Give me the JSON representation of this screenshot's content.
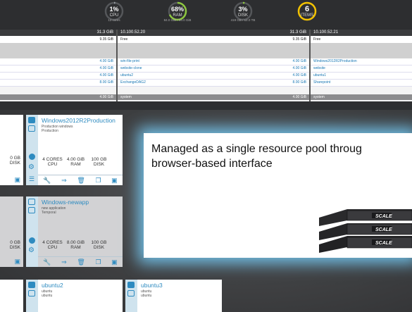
{
  "gauges": [
    {
      "value": "1%",
      "label": "CPU",
      "sub": "12 cores",
      "color": "#9aa0a6",
      "fraction": 0.01
    },
    {
      "value": "68%",
      "label": "RAM",
      "sub": "84.0 GiB / 94.0 GiB",
      "color": "#8dc63f",
      "fraction": 0.68
    },
    {
      "value": "3%",
      "label": "DISK",
      "sub": "419 GB / 12.0 TB",
      "color": "#8dc63f",
      "fraction": 0.03
    },
    {
      "value": "6",
      "label": "ITEMS",
      "sub": "",
      "color": "#f2c200",
      "fraction": 1.0
    }
  ],
  "nodes": [
    {
      "name": "",
      "capacity": "31.3 GiB",
      "free_label": "",
      "free_value": "9.35 GiB",
      "vms": [
        {
          "name": "",
          "size": "4.00 GiB"
        },
        {
          "name": "",
          "size": "4.00 GiB"
        },
        {
          "name": "",
          "size": "4.00 GiB"
        },
        {
          "name": "",
          "size": "8.00 GiB"
        }
      ],
      "system_label": "",
      "system_value": "4.00 GiB"
    },
    {
      "name": "10.100.52.20",
      "capacity": "31.3 GiB",
      "free_label": "Free",
      "free_value": "9.35 GiB",
      "vms": [
        {
          "name": "win-file-print",
          "size": "4.00 GiB"
        },
        {
          "name": "website-clone",
          "size": "4.00 GiB"
        },
        {
          "name": "ubuntu2",
          "size": "4.00 GiB"
        },
        {
          "name": "ExchangeDAG2",
          "size": "8.00 GiB"
        }
      ],
      "system_label": "system",
      "system_value": "4.00 GiB"
    },
    {
      "name": "10.100.52.21",
      "capacity": "",
      "free_label": "Free",
      "free_value": "",
      "vms": [
        {
          "name": "Windows2012R2Production",
          "size": ""
        },
        {
          "name": "website",
          "size": ""
        },
        {
          "name": "ubuntu1",
          "size": ""
        },
        {
          "name": "Sharepoint",
          "size": ""
        }
      ],
      "system_label": "system",
      "system_value": ""
    }
  ],
  "left_cards": [
    {
      "line1": "0 GB",
      "line2": "DISK"
    },
    {
      "line1": "0 GB",
      "line2": "DISK"
    }
  ],
  "vm_cards": [
    {
      "name": "Windows2012R2Production",
      "desc1": "Production windows",
      "desc2": "Production",
      "cores": "4 CORES",
      "cores_sub": "CPU",
      "ram": "4.00 GiB",
      "ram_sub": "RAM",
      "disk": "100 GB",
      "disk_sub": "DISK"
    },
    {
      "name": "Windows-newapp",
      "desc1": "new application",
      "desc2": "Temporal",
      "cores": "4 CORES",
      "cores_sub": "CPU",
      "ram": "8.00 GiB",
      "ram_sub": "RAM",
      "disk": "100 GB",
      "disk_sub": "DISK"
    },
    {
      "name": "ubuntu2",
      "desc1": "ubuntu",
      "desc2": "ubuntu"
    },
    {
      "name": "ubuntu3",
      "desc1": "ubuntu",
      "desc2": "ubuntu"
    }
  ],
  "callout": {
    "line1": "Managed as a single resource pool throug",
    "line2": "browser-based interface"
  },
  "logo_text": "SCALE",
  "colors": {
    "accent": "#2e8bc0",
    "glow": "#78d2ff",
    "ram_green": "#8dc63f",
    "items_yellow": "#f2c200"
  }
}
